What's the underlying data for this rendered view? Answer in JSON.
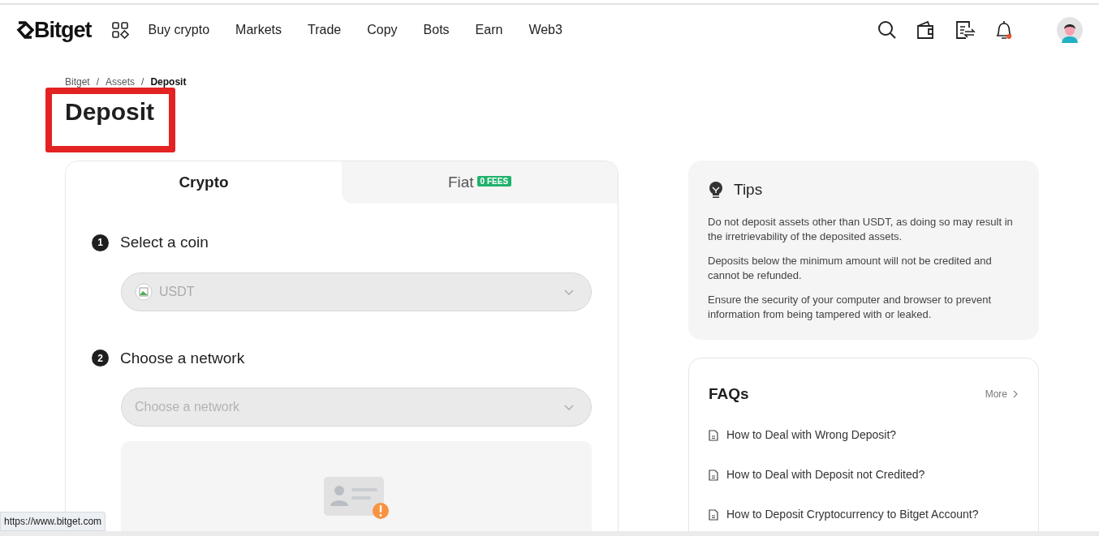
{
  "header": {
    "logo": "Bitget",
    "nav": [
      {
        "label": "Buy crypto"
      },
      {
        "label": "Markets"
      },
      {
        "label": "Trade"
      },
      {
        "label": "Copy"
      },
      {
        "label": "Bots"
      },
      {
        "label": "Earn"
      },
      {
        "label": "Web3"
      }
    ],
    "notifications_unread": true
  },
  "breadcrumb": [
    {
      "label": "Bitget",
      "current": false
    },
    {
      "label": "Assets",
      "current": false
    },
    {
      "label": "Deposit",
      "current": true
    }
  ],
  "breadcrumb_separator": "/",
  "title": "Deposit",
  "title_highlighted": true,
  "tabs": [
    {
      "label": "Crypto",
      "selected": true
    },
    {
      "label": "Fiat",
      "selected": false,
      "badge": "0 FEES"
    }
  ],
  "steps": [
    {
      "number": "1",
      "label": "Select a coin",
      "field": {
        "value": "USDT"
      }
    },
    {
      "number": "2",
      "label": "Choose a network",
      "field": {
        "placeholder": "Choose a network"
      }
    }
  ],
  "tips": {
    "title": "Tips",
    "items": [
      "Do not deposit assets other than USDT, as doing so may result in the irretrievability of the deposited assets.",
      "Deposits below the minimum amount will not be credited and cannot be refunded.",
      "Ensure the security of your computer and browser to prevent information from being tampered with or leaked."
    ]
  },
  "faqs": {
    "title": "FAQs",
    "more": "More",
    "items": [
      "How to Deal with Wrong Deposit?",
      "How to Deal with Deposit not Credited?",
      "How to Deposit Cryptocurrency to Bitget Account?"
    ]
  },
  "status_bar": "https://www.bitget.com"
}
